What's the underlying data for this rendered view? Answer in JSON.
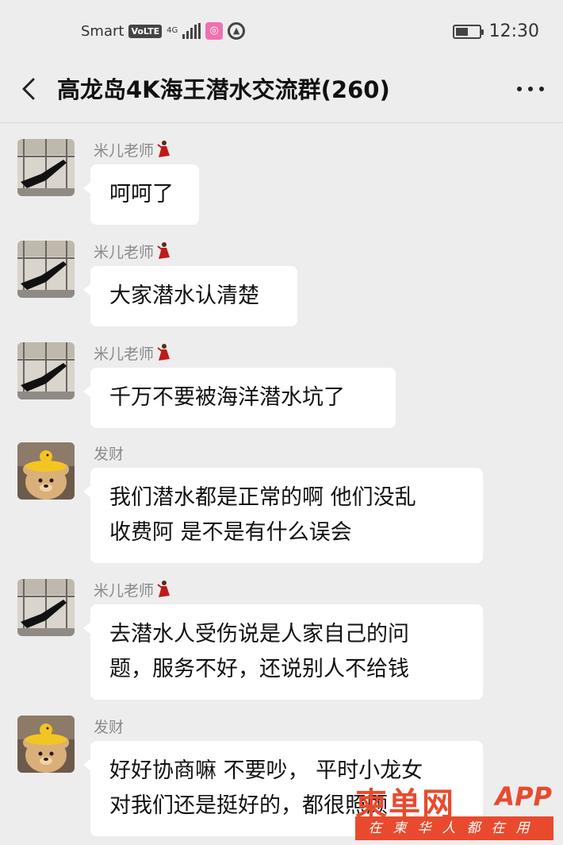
{
  "status_bar": {
    "carrier": "Smart",
    "volte_badge": "VoLTE",
    "network_type": "4G",
    "time": "12:30",
    "battery_level": 0.55
  },
  "nav": {
    "title": "高龙岛4K海王潜水交流群(260)"
  },
  "messages": [
    {
      "sender": "米儿老师",
      "avatar": "dance-avatar",
      "text_lines": [
        "呵呵了"
      ]
    },
    {
      "sender": "米儿老师",
      "avatar": "dance-avatar",
      "text_lines": [
        "大家潜水认清楚"
      ]
    },
    {
      "sender": "米儿老师",
      "avatar": "dance-avatar",
      "text_lines": [
        "千万不要被海洋潜水坑了"
      ]
    },
    {
      "sender": "发财",
      "avatar": "teddy-bear-avatar",
      "text_lines": [
        "我们潜水都是正常的啊 他们没乱",
        "收费阿 是不是有什么误会"
      ]
    },
    {
      "sender": "米儿老师",
      "avatar": "dance-avatar",
      "text_lines": [
        "去潜水人受伤说是人家自己的问",
        "题，服务不好，还说别人不给钱"
      ]
    },
    {
      "sender": "发财",
      "avatar": "teddy-bear-avatar",
      "text_lines": [
        "好好协商嘛 不要吵， 平时小龙女",
        "对我们还是挺好的，都很照顾"
      ]
    }
  ],
  "watermark": {
    "brand": "柬单网",
    "app": "APP",
    "slogan": "在柬华人都在用"
  },
  "colors": {
    "background": "#ededed",
    "bubble": "#ffffff",
    "watermark_red": "#e94a2e"
  }
}
